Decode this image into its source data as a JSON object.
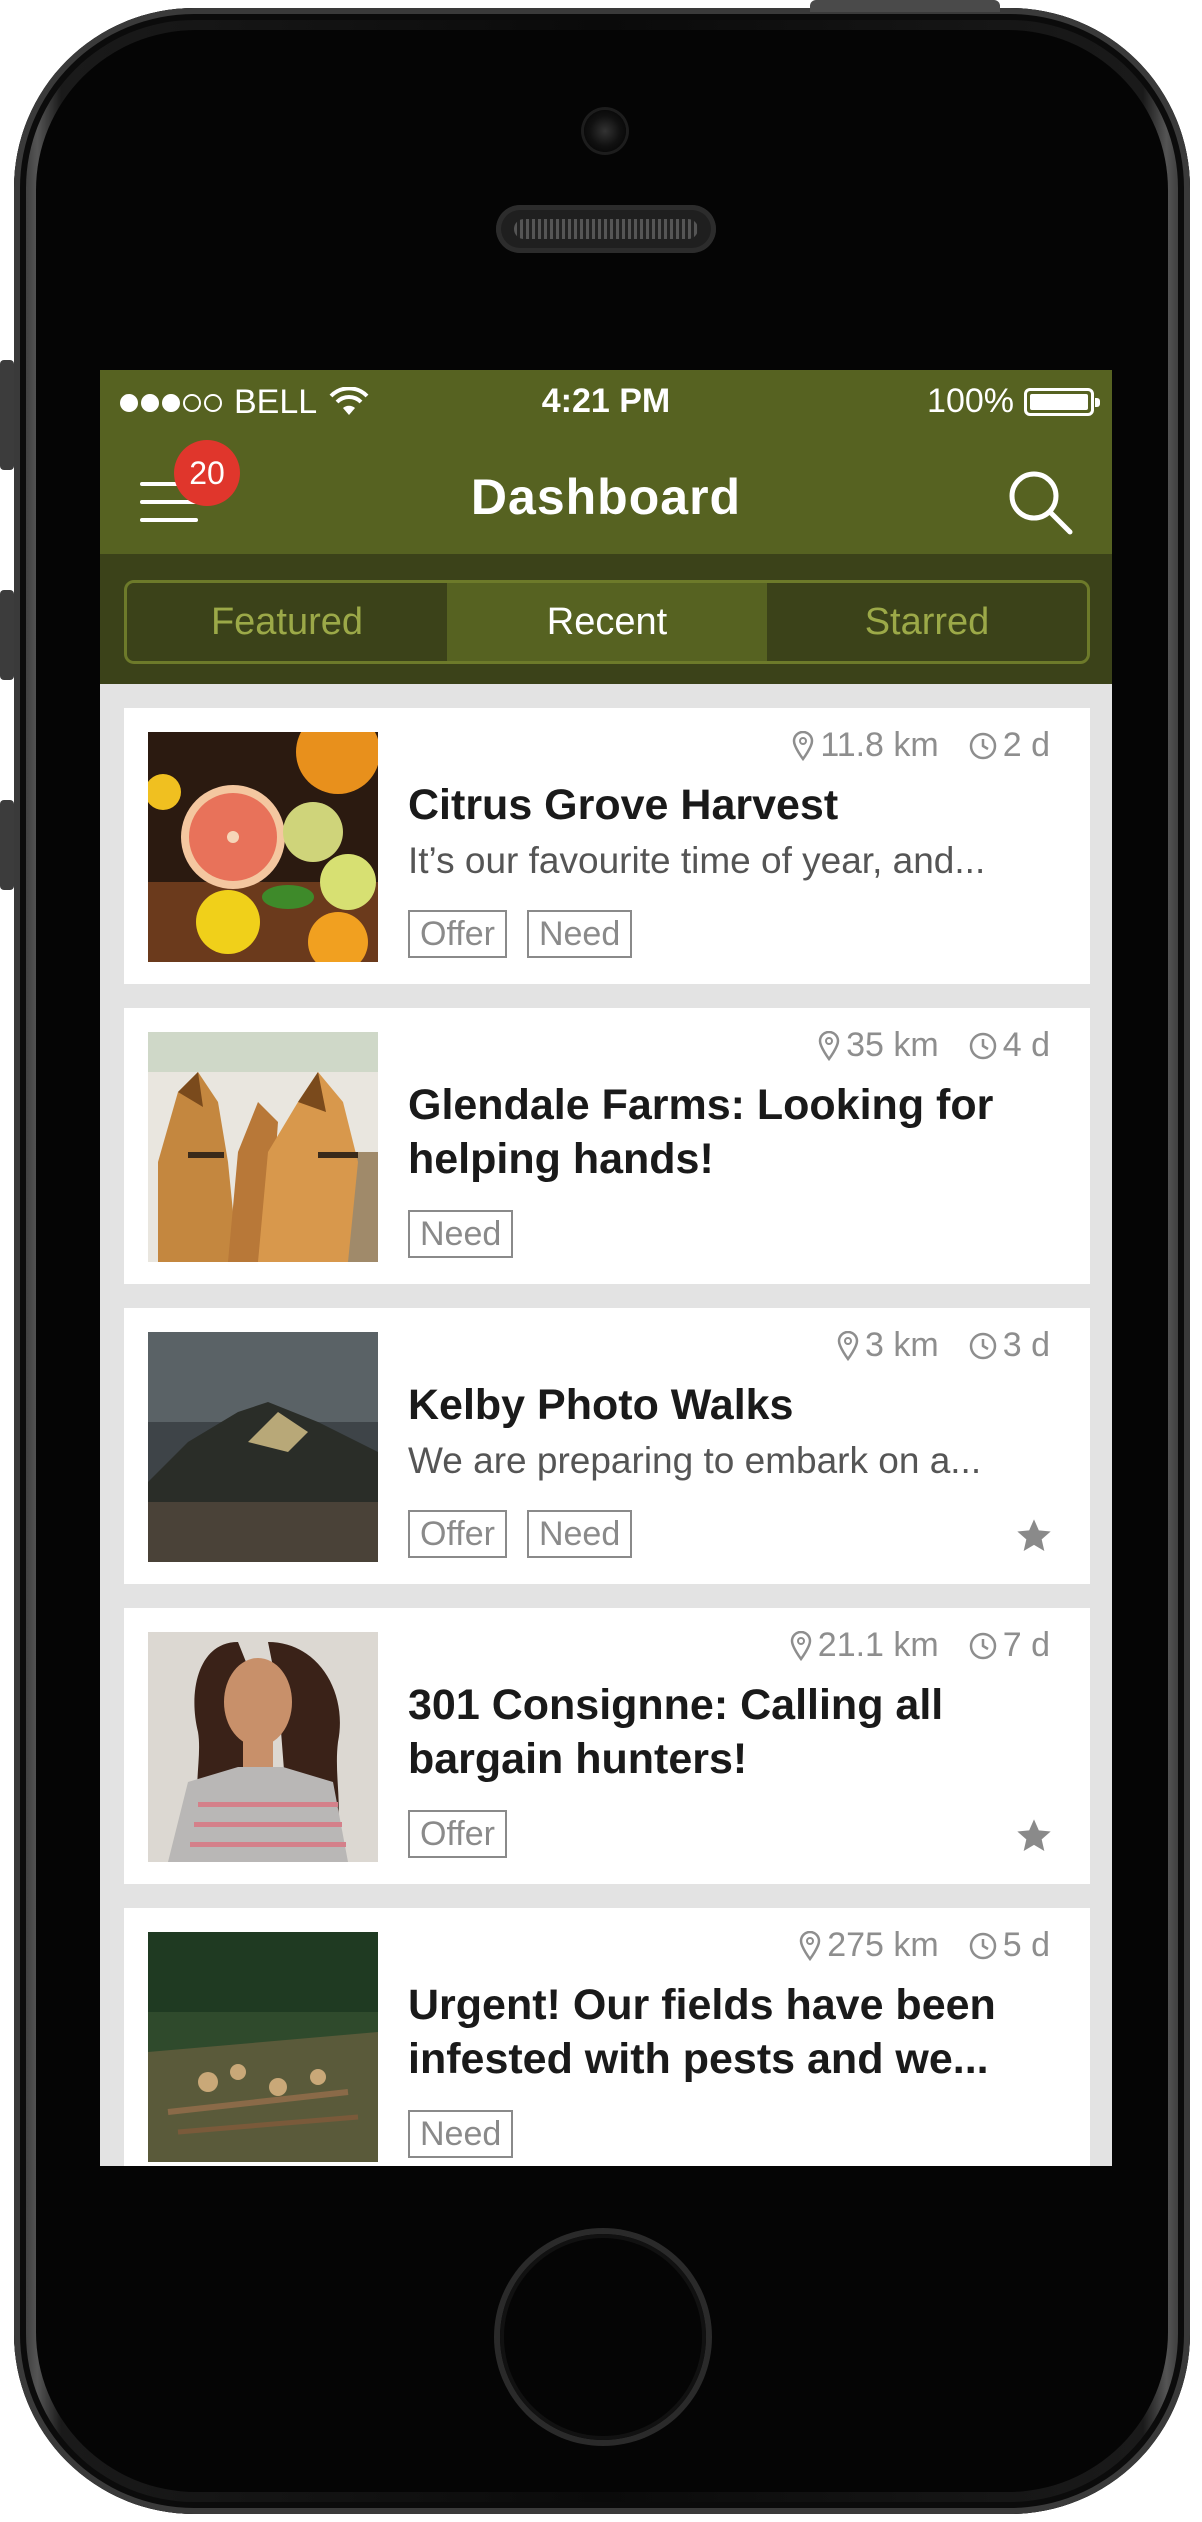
{
  "status_bar": {
    "carrier": "BELL",
    "time": "4:21 PM",
    "battery": "100%",
    "signal_bars_filled": 3,
    "signal_bars_total": 5
  },
  "nav": {
    "title": "Dashboard",
    "menu_badge": "20",
    "menu_icon": "hamburger-menu-icon",
    "search_icon": "search-icon"
  },
  "tabs": {
    "items": [
      "Featured",
      "Recent",
      "Starred"
    ],
    "active": "Recent"
  },
  "colors": {
    "brand": "#566221",
    "brand_dark": "#3b4219",
    "badge": "#e0362c"
  },
  "cards": [
    {
      "distance": "11.8 km",
      "age": "2 d",
      "title": "Citrus Grove Harvest",
      "description": "It’s our favourite time of year, and...",
      "tags": [
        "Offer",
        "Need"
      ],
      "starred": false,
      "image": "citrus-fruit-photo"
    },
    {
      "distance": "35 km",
      "age": "4 d",
      "title": "Glendale Farms: Looking for helping hands!",
      "description": "",
      "tags": [
        "Need"
      ],
      "starred": false,
      "image": "horses-photo"
    },
    {
      "distance": "3 km",
      "age": "3 d",
      "title": "Kelby Photo Walks",
      "description": "We are preparing to embark on a...",
      "tags": [
        "Offer",
        "Need"
      ],
      "starred": true,
      "image": "mountain-landscape-photo"
    },
    {
      "distance": "21.1 km",
      "age": "7 d",
      "title": "301 Consignne: Calling all bargain hunters!",
      "description": "",
      "tags": [
        "Offer"
      ],
      "starred": true,
      "image": "woman-portrait-photo"
    },
    {
      "distance": "275 km",
      "age": "5 d",
      "title": "Urgent! Our fields have been infested with pests and we...",
      "description": "",
      "tags": [
        "Need"
      ],
      "starred": false,
      "image": "cut-branches-field-photo"
    }
  ]
}
